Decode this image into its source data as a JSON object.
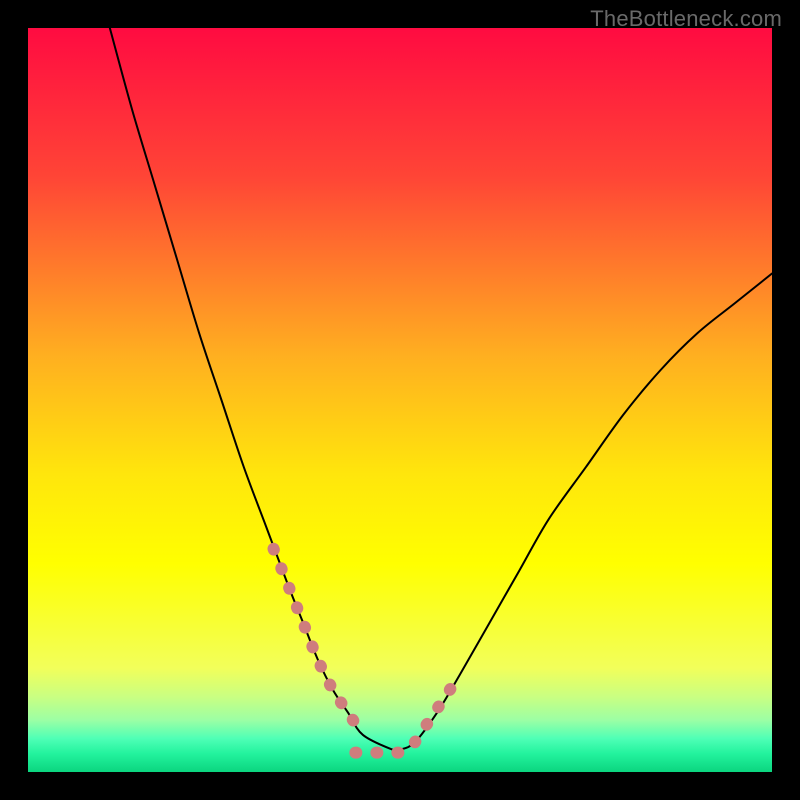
{
  "watermark": "TheBottleneck.com",
  "chart_data": {
    "type": "line",
    "title": "",
    "xlabel": "",
    "ylabel": "",
    "xlim": [
      0,
      100
    ],
    "ylim": [
      0,
      100
    ],
    "legend": false,
    "grid": false,
    "series": [
      {
        "name": "black-curve",
        "color": "#000000",
        "x": [
          11,
          14,
          17,
          20,
          23,
          26,
          29,
          32,
          35,
          37,
          39,
          41,
          43,
          45,
          49,
          50,
          52,
          55,
          58,
          62,
          66,
          70,
          75,
          80,
          85,
          90,
          95,
          100
        ],
        "y": [
          100,
          89,
          79,
          69,
          59,
          50,
          41,
          33,
          25,
          20,
          15,
          11,
          8,
          5,
          3,
          3,
          4,
          8,
          13,
          20,
          27,
          34,
          41,
          48,
          54,
          59,
          63,
          67
        ]
      },
      {
        "name": "pink-left-segment",
        "color": "#cf7d7d",
        "x": [
          33,
          35,
          37,
          39,
          41,
          43,
          45
        ],
        "y": [
          30,
          25,
          20,
          15,
          11,
          8,
          5
        ]
      },
      {
        "name": "pink-bottom-segment",
        "color": "#cf7d7d",
        "x": [
          44,
          46,
          48,
          50,
          52
        ],
        "y": [
          2.6,
          2.6,
          2.6,
          2.6,
          2.6
        ]
      },
      {
        "name": "pink-right-segment",
        "color": "#cf7d7d",
        "x": [
          52,
          54,
          56,
          58
        ],
        "y": [
          4,
          7,
          10,
          13
        ]
      }
    ],
    "background_gradient": {
      "type": "vertical",
      "stops": [
        {
          "offset": 0,
          "color": "#ff0b41"
        },
        {
          "offset": 20,
          "color": "#ff4536"
        },
        {
          "offset": 44,
          "color": "#ffaf20"
        },
        {
          "offset": 60,
          "color": "#ffe60c"
        },
        {
          "offset": 72,
          "color": "#ffff00"
        },
        {
          "offset": 86,
          "color": "#f2ff5a"
        },
        {
          "offset": 90,
          "color": "#c8ff83"
        },
        {
          "offset": 93,
          "color": "#9cffa4"
        },
        {
          "offset": 95.5,
          "color": "#4fffb6"
        },
        {
          "offset": 97.5,
          "color": "#23f39e"
        },
        {
          "offset": 100,
          "color": "#0bd57f"
        }
      ]
    }
  }
}
